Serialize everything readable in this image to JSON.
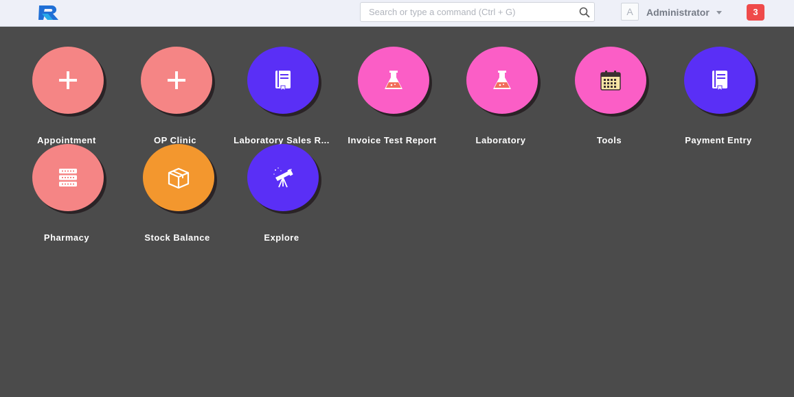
{
  "navbar": {
    "search_placeholder": "Search or type a command (Ctrl + G)",
    "avatar_initial": "A",
    "user_name": "Administrator",
    "notification_count": "3"
  },
  "colors": {
    "salmon": "#f58585",
    "pink": "#fb5ec6",
    "purple": "#5a2ff6",
    "orange": "#f3972e",
    "badge_red": "#ef4a4a"
  },
  "tiles": [
    {
      "label": "Appointment",
      "icon": "plus-icon",
      "color": "salmon"
    },
    {
      "label": "OP Clinic",
      "icon": "plus-icon",
      "color": "salmon"
    },
    {
      "label": "Laboratory Sales R...",
      "icon": "book-icon",
      "color": "purple"
    },
    {
      "label": "Invoice Test Report",
      "icon": "flask-icon",
      "color": "pink"
    },
    {
      "label": "Laboratory",
      "icon": "flask-icon",
      "color": "pink"
    },
    {
      "label": "Tools",
      "icon": "calendar-icon",
      "color": "pink"
    },
    {
      "label": "Payment Entry",
      "icon": "book-icon",
      "color": "purple"
    },
    {
      "label": "Pharmacy",
      "icon": "server-icon",
      "color": "salmon"
    },
    {
      "label": "Stock Balance",
      "icon": "box-icon",
      "color": "orange"
    },
    {
      "label": "Explore",
      "icon": "telescope-icon",
      "color": "purple"
    }
  ]
}
